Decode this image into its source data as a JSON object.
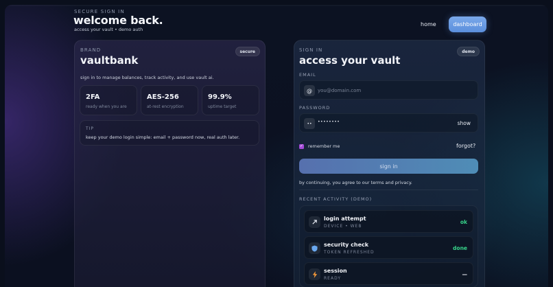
{
  "header": {
    "eyebrow": "SECURE SIGN IN",
    "title": "welcome back.",
    "subtitle": "access your vault • demo auth"
  },
  "nav": {
    "home": "home",
    "dashboard": "dashboard"
  },
  "brand_card": {
    "eyebrow": "BRAND",
    "badge": "secure",
    "name": "vaultbank",
    "description": "sign in to manage balances, track activity, and use vault ai.",
    "stats": [
      {
        "value": "2FA",
        "caption": "ready when you are"
      },
      {
        "value": "AES-256",
        "caption": "at-rest encryption"
      },
      {
        "value": "99.9%",
        "caption": "uptime target"
      }
    ],
    "tip": {
      "label": "TIP",
      "text": "keep your demo login simple: email + password now, real auth later."
    }
  },
  "signin_card": {
    "eyebrow": "SIGN IN",
    "badge": "demo",
    "title": "access your vault",
    "email": {
      "label": "EMAIL",
      "icon": "at-icon",
      "icon_glyph": "@",
      "placeholder": "you@domain.com",
      "value": ""
    },
    "password": {
      "label": "PASSWORD",
      "icon": "key-dots-icon",
      "icon_glyph": "••",
      "masked_value": "••••••••",
      "show_label": "show"
    },
    "remember_label": "remember me",
    "remember_checked": true,
    "forgot_label": "forgot?",
    "submit_label": "sign in",
    "terms": "by continuing, you agree to our terms and privacy.",
    "activity": {
      "label": "RECENT ACTIVITY (DEMO)",
      "items": [
        {
          "title": "login attempt",
          "sub": "DEVICE • WEB",
          "status": "ok",
          "status_color": "#37d38a",
          "icon": "arrow-icon"
        },
        {
          "title": "security check",
          "sub": "TOKEN REFRESHED",
          "status": "done",
          "status_color": "#37d38a",
          "icon": "shield-icon"
        },
        {
          "title": "session",
          "sub": "READY",
          "status": "—",
          "status_color": "#f2f4f9",
          "icon": "bolt-icon"
        }
      ]
    }
  },
  "colors": {
    "accent": "#6a9be6",
    "success": "#37d38a",
    "checkbox": "#a44bd8"
  }
}
